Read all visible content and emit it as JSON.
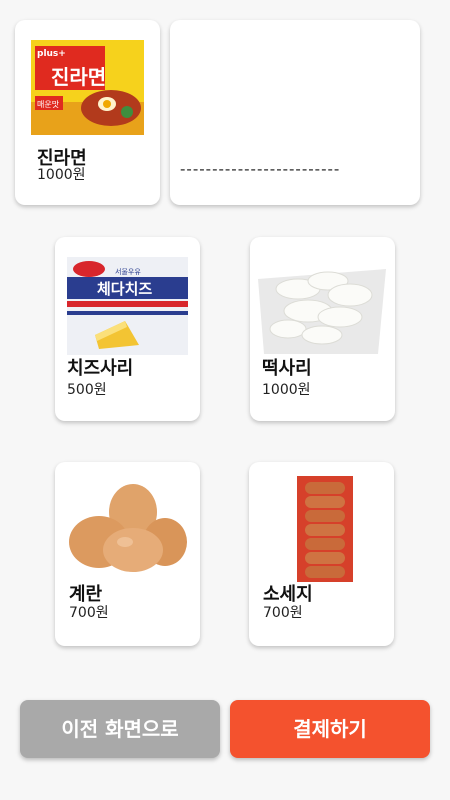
{
  "menu": {
    "items": [
      {
        "name": "진라면",
        "price": "1000원"
      },
      {
        "name": "치즈사리",
        "price": "500원"
      },
      {
        "name": "떡사리",
        "price": "1000원"
      },
      {
        "name": "계란",
        "price": "700원"
      },
      {
        "name": "소세지",
        "price": "700원"
      }
    ]
  },
  "ramen_pack": {
    "brand": "plus+",
    "title": "진라면",
    "flavor": "매운맛"
  },
  "cheese_pack": {
    "brand": "서울우유",
    "title": "체다치즈"
  },
  "order_panel": {
    "separator": "-------------------------"
  },
  "buttons": {
    "prev_label": "이전 화면으로",
    "pay_label": "결제하기"
  },
  "colors": {
    "pay": "#f4522e",
    "prev": "#a9a9a9"
  }
}
